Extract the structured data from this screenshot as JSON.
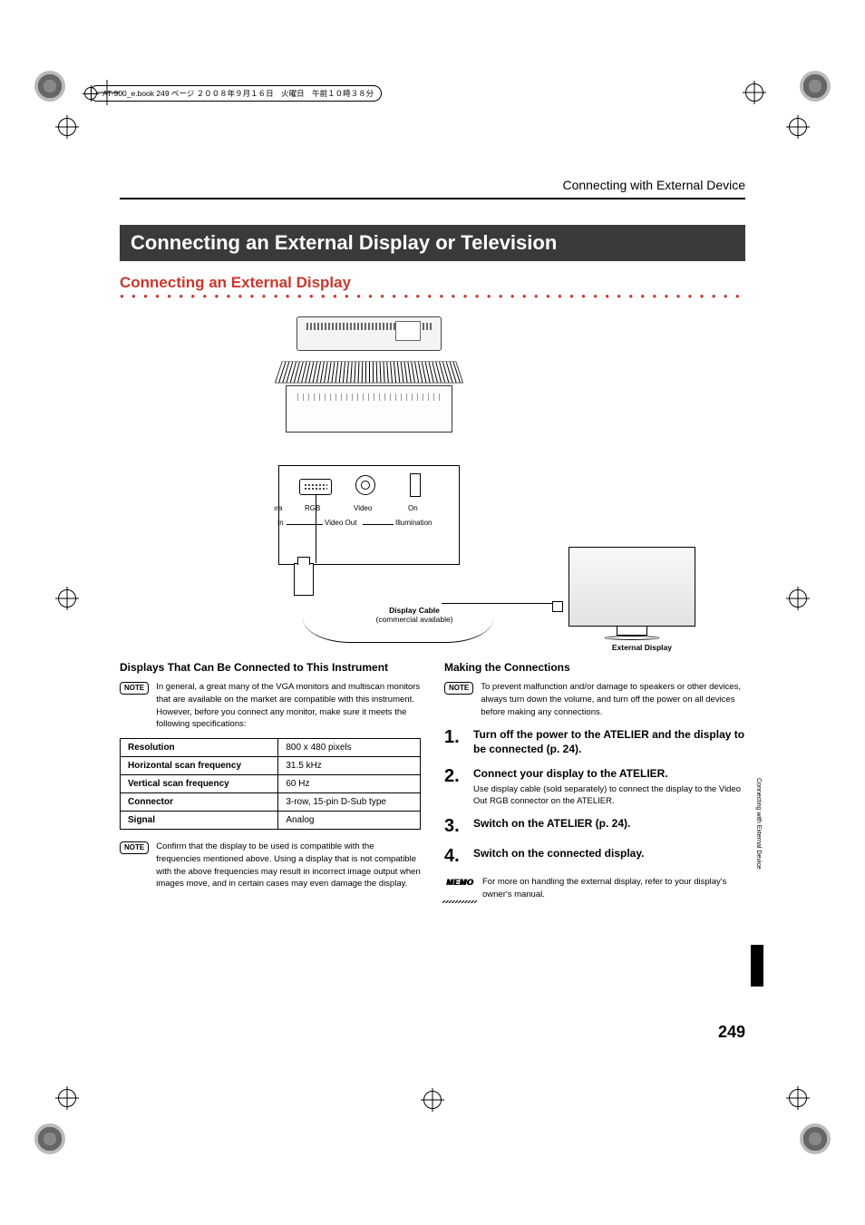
{
  "bookline": "AT-900_e.book  249 ページ  ２００８年９月１６日　火曜日　午前１０時３８分",
  "running_head": "Connecting with External Device",
  "h1": "Connecting an External Display or Television",
  "h2": "Connecting an External Display",
  "diagram": {
    "rgb": "RGB",
    "video": "Video",
    "on": "On",
    "era": "ıra",
    "in": "In",
    "videoout": "Video Out",
    "illum": "Illumination",
    "cable_t": "Display Cable",
    "cable_s": "(commercial available)",
    "extdisp": "External Display"
  },
  "left": {
    "h3": "Displays That Can Be Connected to This Instrument",
    "note1": "In general, a great many of the VGA monitors and multiscan monitors that are available on the market are compatible with this instrument. However, before you connect any monitor, make sure it meets the following specifications:",
    "table": {
      "r1k": "Resolution",
      "r1v": "800 x 480 pixels",
      "r2k": "Horizontal scan frequency",
      "r2v": "31.5 kHz",
      "r3k": "Vertical scan frequency",
      "r3v": "60 Hz",
      "r4k": "Connector",
      "r4v": "3-row, 15-pin D-Sub type",
      "r5k": "Signal",
      "r5v": "Analog"
    },
    "note2": "Confirm that the display to be used is compatible with the frequencies mentioned above. Using a display that is not compatible with the above frequencies may result in incorrect image output when images move, and in certain cases may even damage the display."
  },
  "right": {
    "h3": "Making the Connections",
    "note1": "To prevent malfunction and/or damage to speakers or other devices, always turn down the volume, and turn off the power on all devices before making any connections.",
    "s1": "Turn off the power to the ATELIER and the display to be connected (p. 24).",
    "s2": "Connect your display to the ATELIER.",
    "s2sub": "Use display cable (sold separately) to connect the display to the Video Out RGB connector on the ATELIER.",
    "s3": "Switch on the ATELIER (p. 24).",
    "s4": "Switch on the connected display.",
    "memo": "For more on handling the external display, refer to your display's owner's manual."
  },
  "side": "Connecting with External Device",
  "page": "249",
  "note_label": "NOTE",
  "memo_label": "MEMO"
}
